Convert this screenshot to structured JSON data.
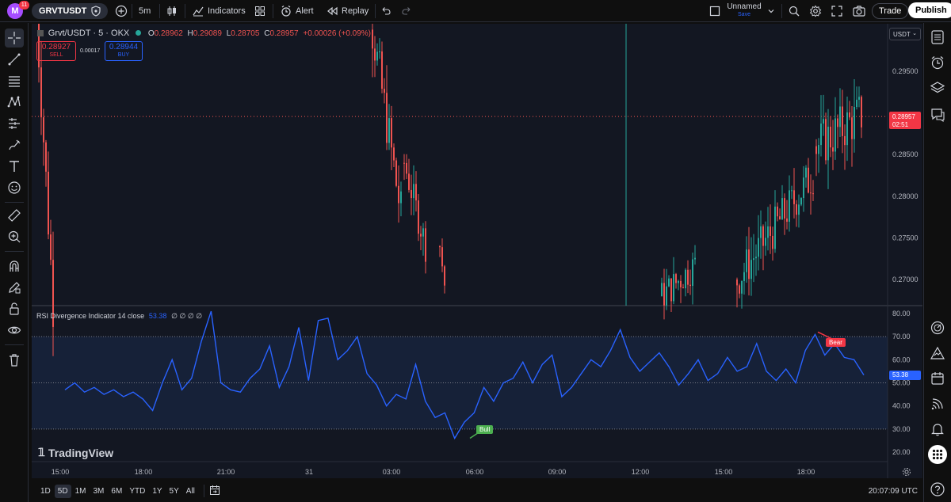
{
  "topbar": {
    "avatar_letter": "M",
    "notification_count": "11",
    "symbol": "GRVTUSDT",
    "interval": "5m",
    "indicators_label": "Indicators",
    "alert_label": "Alert",
    "replay_label": "Replay",
    "layout_name": "Unnamed",
    "layout_status": "Save",
    "trade_label": "Trade",
    "publish_label": "Publish"
  },
  "legend": {
    "title": "Grvt/USDT · 5 · OKX",
    "o_label": "O",
    "o_value": "0.28962",
    "h_label": "H",
    "h_value": "0.29089",
    "l_label": "L",
    "l_value": "0.28705",
    "c_label": "C",
    "c_value": "0.28957",
    "change": "+0.00026 (+0.09%)",
    "sell_price": "0.28927",
    "sell_label": "SELL",
    "spread": "0.00017",
    "buy_price": "0.28944",
    "buy_label": "BUY"
  },
  "currency_selector": "USDT",
  "price_axis": {
    "ticks": [
      "0.29500",
      "0.28500",
      "0.28000",
      "0.27500",
      "0.27000"
    ],
    "last_price": "0.28957",
    "countdown": "02:51"
  },
  "rsi_panel": {
    "title": "RSI Divergence Indicator 14 close",
    "value": "53.38",
    "extras": "∅ ∅ ∅ ∅",
    "ticks": [
      "80.00",
      "70.00",
      "60.00",
      "50.00",
      "40.00",
      "30.00",
      "20.00"
    ],
    "bull_label": "Bull",
    "bear_label": "Bear",
    "current_value_tag": "53.38"
  },
  "watermark": "TradingView",
  "time_axis": [
    "15:00",
    "18:00",
    "21:00",
    "31",
    "03:00",
    "06:00",
    "09:00",
    "12:00",
    "15:00",
    "18:00"
  ],
  "bottombar": {
    "ranges": [
      "1D",
      "5D",
      "1M",
      "3M",
      "6M",
      "YTD",
      "1Y",
      "5Y",
      "All"
    ],
    "active_range": "5D",
    "clock": "20:07:09 UTC"
  },
  "colors": {
    "up": "#26a69a",
    "down": "#ef5350",
    "rsi_line": "#2962ff",
    "bull": "#4caf50",
    "bear": "#f23645",
    "band_fill": "#1a2a4a"
  },
  "chart_data": {
    "type": "candlestick",
    "series": [
      {
        "name": "RSI Divergence Indicator 14 close",
        "values": [
          47,
          50,
          46,
          48,
          45,
          47,
          44,
          46,
          43,
          38,
          50,
          60,
          47,
          52,
          68,
          81,
          50,
          47,
          46,
          52,
          56,
          66,
          48,
          57,
          74,
          51,
          77,
          78,
          60,
          64,
          70,
          54,
          49,
          40,
          45,
          43,
          58,
          42,
          35,
          37,
          26,
          33,
          37,
          48,
          42,
          50,
          52,
          59,
          50,
          58,
          62,
          44,
          48,
          54,
          60,
          57,
          64,
          73,
          61,
          55,
          59,
          63,
          57,
          49,
          54,
          60,
          51,
          54,
          61,
          55,
          57,
          67,
          55,
          51,
          56,
          50,
          64,
          71,
          62,
          67,
          61,
          60,
          53.38
        ]
      }
    ]
  }
}
